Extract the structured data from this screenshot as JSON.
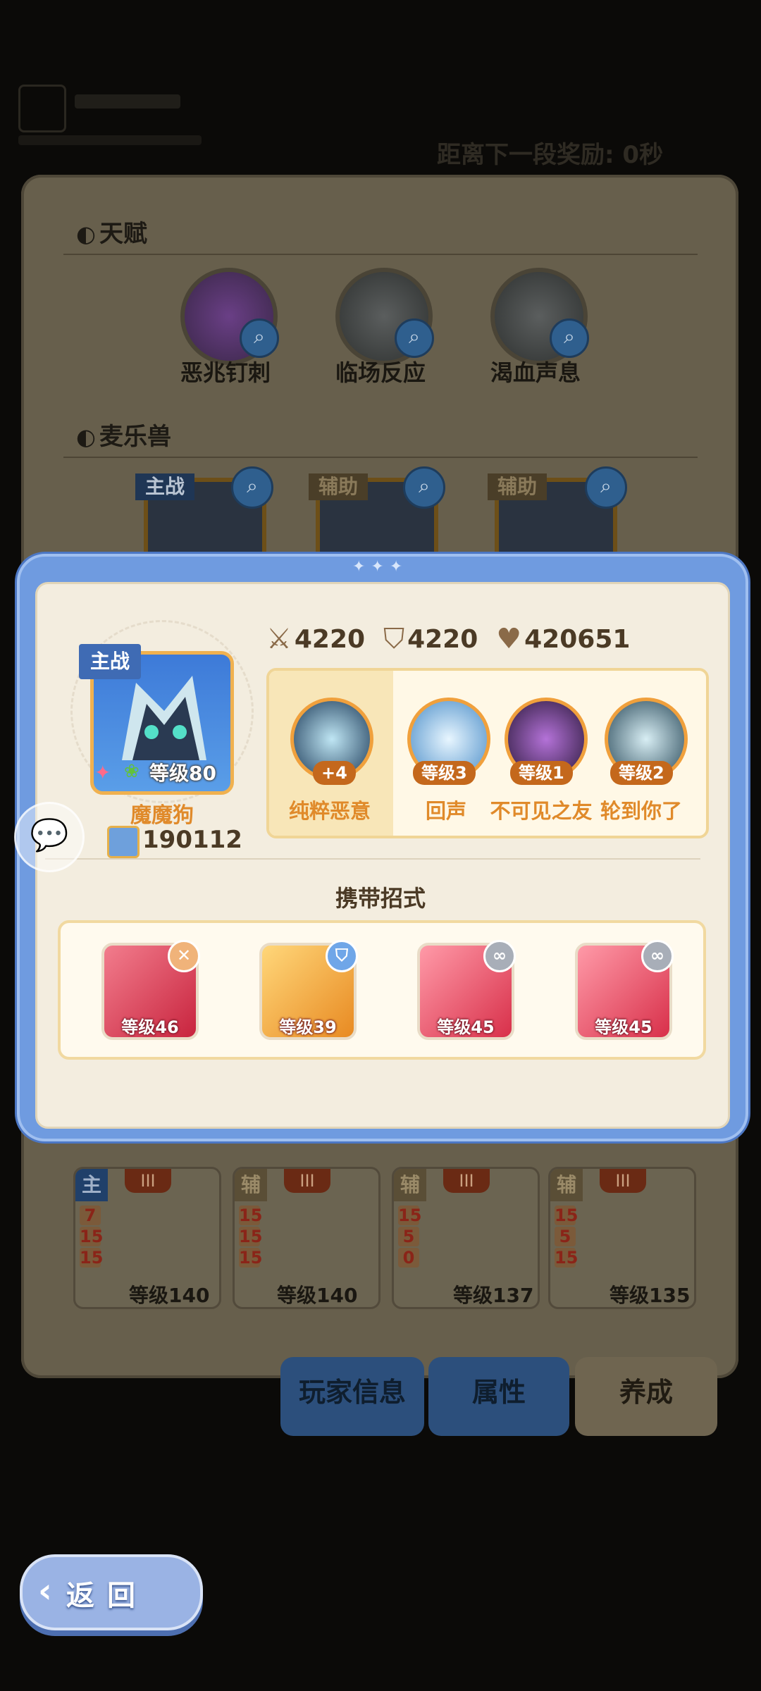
{
  "background": {
    "top_right_text": "距离下一段奖励: 0秒",
    "talents_title": "天赋",
    "talents": [
      {
        "label": "恶兆钉刺",
        "icon": "purple-sword-talent-icon"
      },
      {
        "label": "临场反应",
        "icon": "triangle-talent-icon"
      },
      {
        "label": "渴血声息",
        "icon": "drop-talent-icon"
      }
    ],
    "beasts_title": "麦乐兽",
    "beasts": [
      {
        "tag": "主战"
      },
      {
        "tag": "辅助"
      },
      {
        "tag": "辅助"
      }
    ],
    "pets": [
      {
        "role": "主",
        "tier": "III",
        "stats": [
          "7",
          "15",
          "15"
        ],
        "level": "等级140"
      },
      {
        "role": "辅",
        "tier": "III",
        "stats": [
          "15",
          "15",
          "15"
        ],
        "level": "等级140"
      },
      {
        "role": "辅",
        "tier": "III",
        "stats": [
          "15",
          "5",
          "0"
        ],
        "level": "等级137"
      },
      {
        "role": "辅",
        "tier": "III",
        "stats": [
          "15",
          "5",
          "15"
        ],
        "level": "等级135"
      }
    ],
    "tabs": [
      "玩家信息",
      "属性",
      "养成"
    ],
    "active_tab": "养成"
  },
  "modal": {
    "stats": {
      "attack": "4220",
      "defense": "4220",
      "hp": "420651"
    },
    "role_tag": "主战",
    "avatar_level": "等级80",
    "pet_name": "魔魔狗",
    "power": "190112",
    "skills": [
      {
        "name": "纯粹恶意",
        "badge": "+4",
        "highlighted": true
      },
      {
        "name": "回声",
        "badge": "等级3"
      },
      {
        "name": "不可见之友",
        "badge": "等级1"
      },
      {
        "name": "轮到你了",
        "badge": "等级2"
      }
    ],
    "carry_title": "携带招式",
    "moves": [
      {
        "level": "等级46",
        "badge_icon": "x-icon",
        "badge_color": "#f0b37a",
        "bg": "#e0405a"
      },
      {
        "level": "等级39",
        "badge_icon": "shield-icon",
        "badge_color": "#6fa6e8",
        "bg": "#f0a030"
      },
      {
        "level": "等级45",
        "badge_icon": "link-icon",
        "badge_color": "#a8aeb8",
        "bg": "#e8485e"
      },
      {
        "level": "等级45",
        "badge_icon": "link-icon",
        "badge_color": "#a8aeb8",
        "bg": "#e8485e"
      }
    ]
  },
  "back_button": {
    "label": "返回"
  },
  "colors": {
    "modal_frame": "#6f9be0",
    "panel": "#f3eddf",
    "accent_orange": "#e08a2a",
    "tag_blue": "#3f6bb4"
  }
}
